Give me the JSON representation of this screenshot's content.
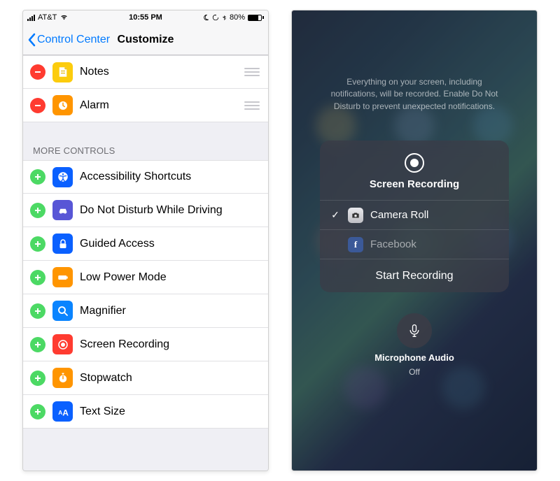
{
  "left": {
    "status": {
      "carrier": "AT&T",
      "time": "10:55 PM",
      "battery": "80%"
    },
    "nav": {
      "back": "Control Center",
      "title": "Customize"
    },
    "included": [
      {
        "id": "notes",
        "label": "Notes",
        "color": "#fccc0d",
        "icon": "note"
      },
      {
        "id": "alarm",
        "label": "Alarm",
        "color": "#ff9500",
        "icon": "clock"
      }
    ],
    "more_header": "MORE CONTROLS",
    "more": [
      {
        "id": "acc",
        "label": "Accessibility Shortcuts",
        "color": "#0a60ff",
        "icon": "accessibility"
      },
      {
        "id": "dnd",
        "label": "Do Not Disturb While Driving",
        "color": "#5856d6",
        "icon": "car"
      },
      {
        "id": "guided",
        "label": "Guided Access",
        "color": "#0a60ff",
        "icon": "lock"
      },
      {
        "id": "lpm",
        "label": "Low Power Mode",
        "color": "#ff9500",
        "icon": "battery"
      },
      {
        "id": "mag",
        "label": "Magnifier",
        "color": "#0a84ff",
        "icon": "search"
      },
      {
        "id": "rec",
        "label": "Screen Recording",
        "color": "#ff3b30",
        "icon": "record"
      },
      {
        "id": "sw",
        "label": "Stopwatch",
        "color": "#ff9500",
        "icon": "stopwatch"
      },
      {
        "id": "text",
        "label": "Text Size",
        "color": "#0a60ff",
        "icon": "textsize"
      }
    ]
  },
  "right": {
    "hint": "Everything on your screen, including notifications, will be recorded. Enable Do Not Disturb to prevent unexpected notifications.",
    "title": "Screen Recording",
    "options": [
      {
        "id": "camroll",
        "label": "Camera Roll",
        "selected": true,
        "icon": "cam"
      },
      {
        "id": "fb",
        "label": "Facebook",
        "selected": false,
        "icon": "fb"
      }
    ],
    "start": "Start Recording",
    "mic": {
      "label": "Microphone Audio",
      "state": "Off"
    }
  }
}
